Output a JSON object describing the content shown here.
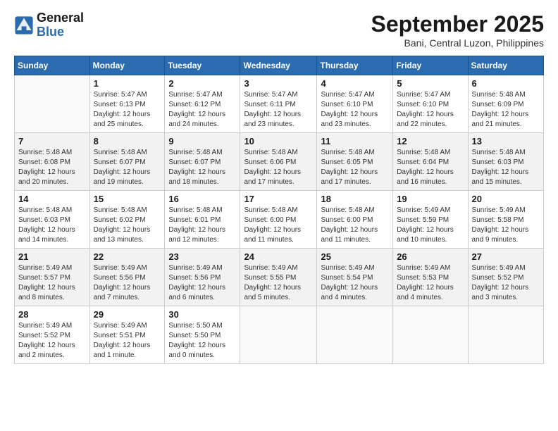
{
  "header": {
    "logo_line1": "General",
    "logo_line2": "Blue",
    "month_title": "September 2025",
    "location": "Bani, Central Luzon, Philippines"
  },
  "weekdays": [
    "Sunday",
    "Monday",
    "Tuesday",
    "Wednesday",
    "Thursday",
    "Friday",
    "Saturday"
  ],
  "weeks": [
    [
      {
        "day": "",
        "info": ""
      },
      {
        "day": "1",
        "info": "Sunrise: 5:47 AM\nSunset: 6:13 PM\nDaylight: 12 hours\nand 25 minutes."
      },
      {
        "day": "2",
        "info": "Sunrise: 5:47 AM\nSunset: 6:12 PM\nDaylight: 12 hours\nand 24 minutes."
      },
      {
        "day": "3",
        "info": "Sunrise: 5:47 AM\nSunset: 6:11 PM\nDaylight: 12 hours\nand 23 minutes."
      },
      {
        "day": "4",
        "info": "Sunrise: 5:47 AM\nSunset: 6:10 PM\nDaylight: 12 hours\nand 23 minutes."
      },
      {
        "day": "5",
        "info": "Sunrise: 5:47 AM\nSunset: 6:10 PM\nDaylight: 12 hours\nand 22 minutes."
      },
      {
        "day": "6",
        "info": "Sunrise: 5:48 AM\nSunset: 6:09 PM\nDaylight: 12 hours\nand 21 minutes."
      }
    ],
    [
      {
        "day": "7",
        "info": "Sunrise: 5:48 AM\nSunset: 6:08 PM\nDaylight: 12 hours\nand 20 minutes."
      },
      {
        "day": "8",
        "info": "Sunrise: 5:48 AM\nSunset: 6:07 PM\nDaylight: 12 hours\nand 19 minutes."
      },
      {
        "day": "9",
        "info": "Sunrise: 5:48 AM\nSunset: 6:07 PM\nDaylight: 12 hours\nand 18 minutes."
      },
      {
        "day": "10",
        "info": "Sunrise: 5:48 AM\nSunset: 6:06 PM\nDaylight: 12 hours\nand 17 minutes."
      },
      {
        "day": "11",
        "info": "Sunrise: 5:48 AM\nSunset: 6:05 PM\nDaylight: 12 hours\nand 17 minutes."
      },
      {
        "day": "12",
        "info": "Sunrise: 5:48 AM\nSunset: 6:04 PM\nDaylight: 12 hours\nand 16 minutes."
      },
      {
        "day": "13",
        "info": "Sunrise: 5:48 AM\nSunset: 6:03 PM\nDaylight: 12 hours\nand 15 minutes."
      }
    ],
    [
      {
        "day": "14",
        "info": "Sunrise: 5:48 AM\nSunset: 6:03 PM\nDaylight: 12 hours\nand 14 minutes."
      },
      {
        "day": "15",
        "info": "Sunrise: 5:48 AM\nSunset: 6:02 PM\nDaylight: 12 hours\nand 13 minutes."
      },
      {
        "day": "16",
        "info": "Sunrise: 5:48 AM\nSunset: 6:01 PM\nDaylight: 12 hours\nand 12 minutes."
      },
      {
        "day": "17",
        "info": "Sunrise: 5:48 AM\nSunset: 6:00 PM\nDaylight: 12 hours\nand 11 minutes."
      },
      {
        "day": "18",
        "info": "Sunrise: 5:48 AM\nSunset: 6:00 PM\nDaylight: 12 hours\nand 11 minutes."
      },
      {
        "day": "19",
        "info": "Sunrise: 5:49 AM\nSunset: 5:59 PM\nDaylight: 12 hours\nand 10 minutes."
      },
      {
        "day": "20",
        "info": "Sunrise: 5:49 AM\nSunset: 5:58 PM\nDaylight: 12 hours\nand 9 minutes."
      }
    ],
    [
      {
        "day": "21",
        "info": "Sunrise: 5:49 AM\nSunset: 5:57 PM\nDaylight: 12 hours\nand 8 minutes."
      },
      {
        "day": "22",
        "info": "Sunrise: 5:49 AM\nSunset: 5:56 PM\nDaylight: 12 hours\nand 7 minutes."
      },
      {
        "day": "23",
        "info": "Sunrise: 5:49 AM\nSunset: 5:56 PM\nDaylight: 12 hours\nand 6 minutes."
      },
      {
        "day": "24",
        "info": "Sunrise: 5:49 AM\nSunset: 5:55 PM\nDaylight: 12 hours\nand 5 minutes."
      },
      {
        "day": "25",
        "info": "Sunrise: 5:49 AM\nSunset: 5:54 PM\nDaylight: 12 hours\nand 4 minutes."
      },
      {
        "day": "26",
        "info": "Sunrise: 5:49 AM\nSunset: 5:53 PM\nDaylight: 12 hours\nand 4 minutes."
      },
      {
        "day": "27",
        "info": "Sunrise: 5:49 AM\nSunset: 5:52 PM\nDaylight: 12 hours\nand 3 minutes."
      }
    ],
    [
      {
        "day": "28",
        "info": "Sunrise: 5:49 AM\nSunset: 5:52 PM\nDaylight: 12 hours\nand 2 minutes."
      },
      {
        "day": "29",
        "info": "Sunrise: 5:49 AM\nSunset: 5:51 PM\nDaylight: 12 hours\nand 1 minute."
      },
      {
        "day": "30",
        "info": "Sunrise: 5:50 AM\nSunset: 5:50 PM\nDaylight: 12 hours\nand 0 minutes."
      },
      {
        "day": "",
        "info": ""
      },
      {
        "day": "",
        "info": ""
      },
      {
        "day": "",
        "info": ""
      },
      {
        "day": "",
        "info": ""
      }
    ]
  ]
}
